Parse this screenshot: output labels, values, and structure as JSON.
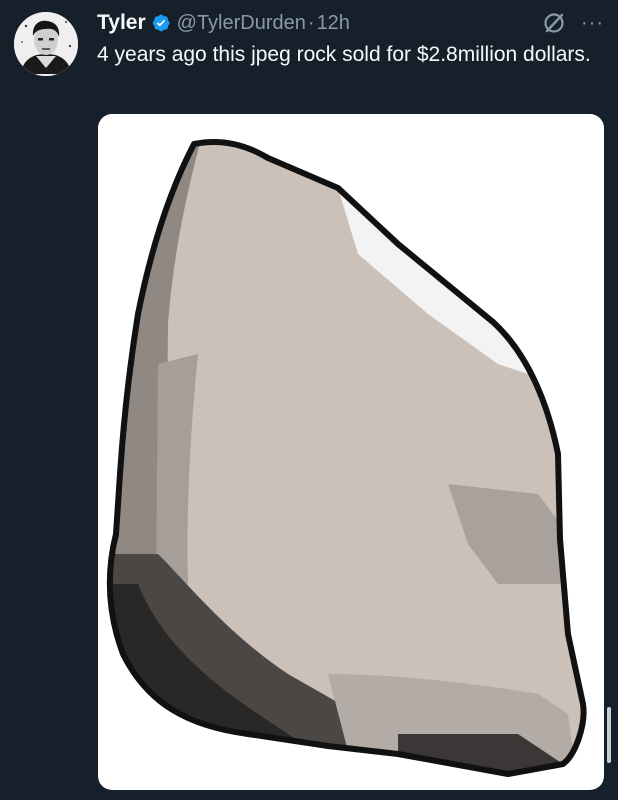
{
  "tweet": {
    "author": {
      "display_name": "Tyler",
      "handle": "@TylerDurden",
      "verified": true,
      "avatar_icon": "profile-avatar-portrait"
    },
    "separator": "·",
    "timestamp": "12h",
    "text": "4 years ago this jpeg rock sold for $2.8million dollars.",
    "actions": {
      "grok_icon": "grok-icon",
      "more_icon": "more-options-icon",
      "more_glyph": "···"
    },
    "media": {
      "type": "image",
      "subject": "rock"
    }
  },
  "colors": {
    "background": "#15202b",
    "text_primary": "#f7f9f9",
    "text_secondary": "#8b98a5",
    "verified_badge": "#1d9bf0"
  }
}
